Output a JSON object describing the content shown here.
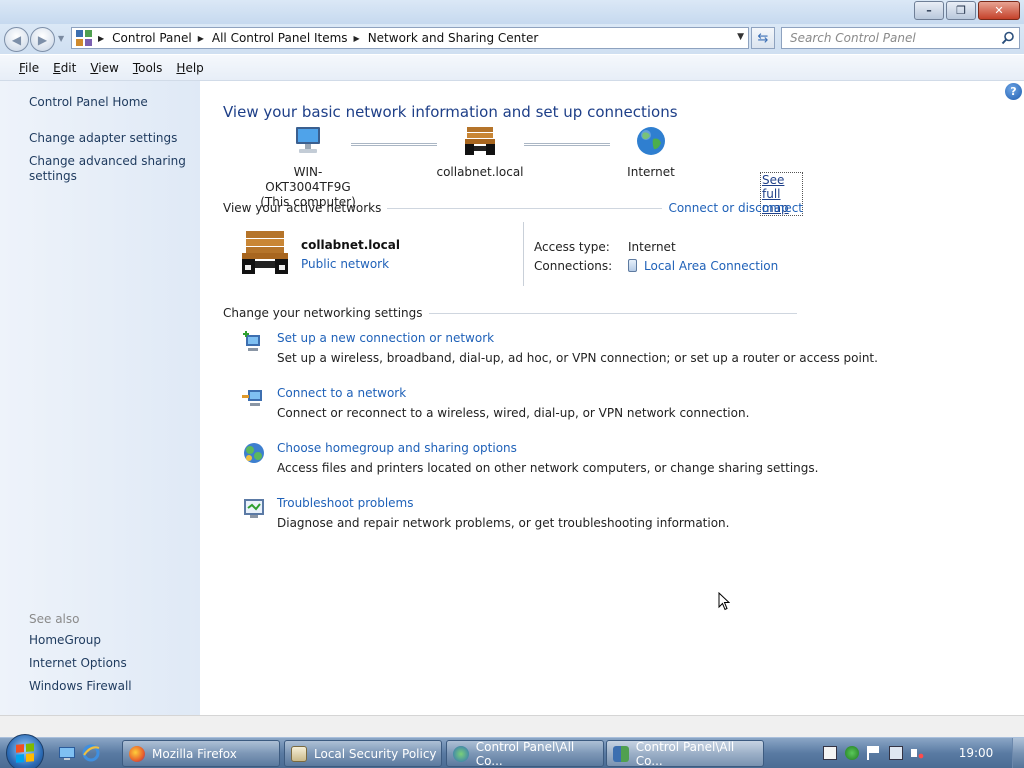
{
  "window": {
    "title_buttons": {
      "minimize": "min-icon",
      "maximize": "max-icon",
      "close": "close-icon"
    }
  },
  "address": {
    "breadcrumbs": [
      "Control Panel",
      "All Control Panel Items",
      "Network and Sharing Center"
    ],
    "search_placeholder": "Search Control Panel"
  },
  "menu": {
    "items": [
      {
        "label": "File",
        "accesskey": "F"
      },
      {
        "label": "Edit",
        "accesskey": "E"
      },
      {
        "label": "View",
        "accesskey": "V"
      },
      {
        "label": "Tools",
        "accesskey": "T"
      },
      {
        "label": "Help",
        "accesskey": "H"
      }
    ]
  },
  "sidebar": {
    "home": "Control Panel Home",
    "tasks": [
      "Change adapter settings",
      "Change advanced sharing settings"
    ],
    "see_also_title": "See also",
    "see_also": [
      "HomeGroup",
      "Internet Options",
      "Windows Firewall"
    ]
  },
  "main": {
    "title": "View your basic network information and set up connections",
    "see_full_map": "See full map",
    "map": [
      {
        "name": "WIN-OKT3004TF9G",
        "sub": "(This computer)",
        "icon": "computer-icon"
      },
      {
        "name": "collabnet.local",
        "sub": "",
        "icon": "bench-icon"
      },
      {
        "name": "Internet",
        "sub": "",
        "icon": "globe-icon"
      }
    ],
    "active_networks_label": "View your active networks",
    "connect_link": "Connect or disconnect",
    "active_network": {
      "name": "collabnet.local",
      "type": "Public network",
      "access_type_label": "Access type:",
      "access_type_value": "Internet",
      "connections_label": "Connections:",
      "connections_value": "Local Area Connection"
    },
    "change_settings_label": "Change your networking settings",
    "tasks": [
      {
        "link": "Set up a new connection or network",
        "desc": "Set up a wireless, broadband, dial-up, ad hoc, or VPN connection; or set up a router or access point.",
        "icon": "new-connection-icon"
      },
      {
        "link": "Connect to a network",
        "desc": "Connect or reconnect to a wireless, wired, dial-up, or VPN network connection.",
        "icon": "connect-network-icon"
      },
      {
        "link": "Choose homegroup and sharing options",
        "desc": "Access files and printers located on other network computers, or change sharing settings.",
        "icon": "homegroup-icon"
      },
      {
        "link": "Troubleshoot problems",
        "desc": "Diagnose and repair network problems, or get troubleshooting information.",
        "icon": "troubleshoot-icon"
      }
    ]
  },
  "taskbar": {
    "buttons": [
      {
        "label": "Mozilla Firefox",
        "icon": "firefox-icon"
      },
      {
        "label": "Local Security Policy",
        "icon": "security-policy-icon"
      },
      {
        "label": "Control Panel\\All Co...",
        "icon": "network-center-icon"
      },
      {
        "label": "Control Panel\\All Co...",
        "icon": "control-panel-icon"
      }
    ],
    "clock": "19:00"
  },
  "colors": {
    "link": "#1f61b8",
    "title": "#1e3f88",
    "sidebar_bg": "#e6eef8",
    "taskbar": "#5a7ba3"
  }
}
